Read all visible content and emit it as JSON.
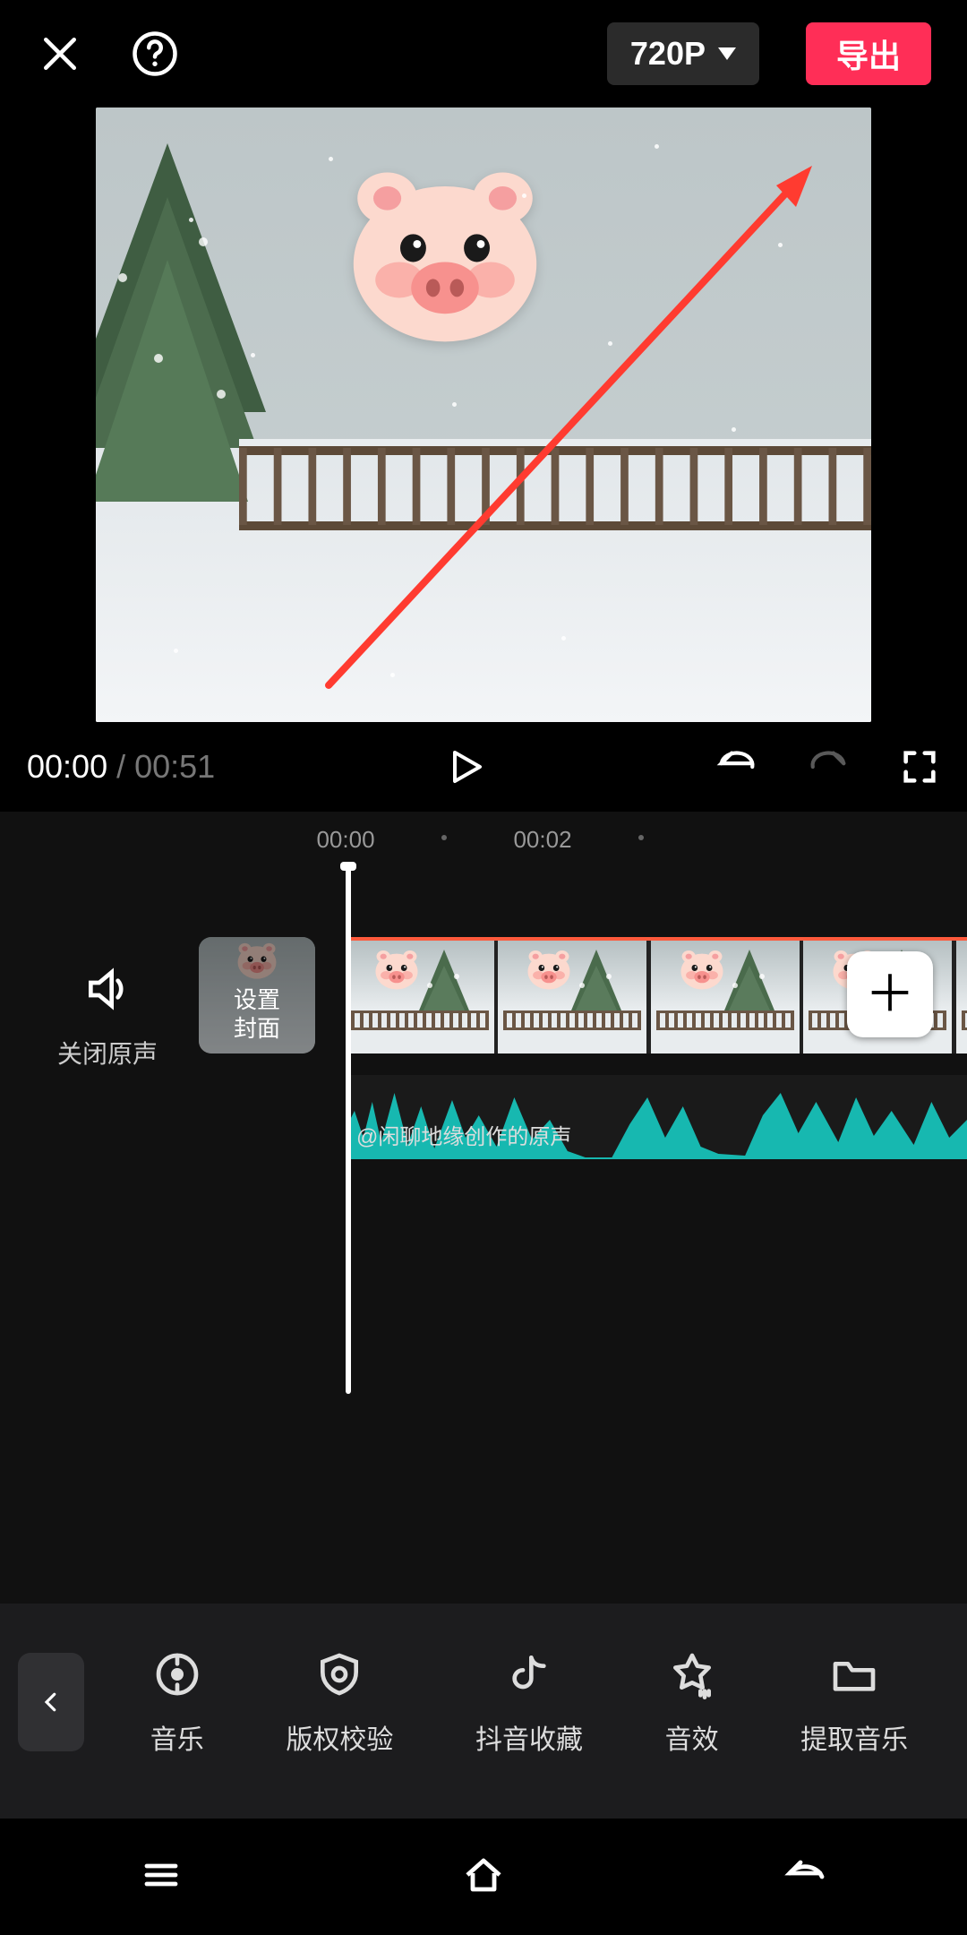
{
  "topbar": {
    "resolution_label": "720P",
    "export_label": "导出"
  },
  "transport": {
    "current_time": "00:00",
    "separator": "/",
    "duration": "00:51"
  },
  "ruler": {
    "ticks": [
      "00:00",
      "00:02"
    ]
  },
  "timeline": {
    "mute_label": "关闭原声",
    "cover_label_line1": "设置",
    "cover_label_line2": "封面",
    "audio_label": "@闲聊地缘创作的原声"
  },
  "tooltabs": {
    "items": [
      {
        "id": "music",
        "label": "音乐"
      },
      {
        "id": "copyright",
        "label": "版权校验"
      },
      {
        "id": "douyin-fav",
        "label": "抖音收藏"
      },
      {
        "id": "sound-fx",
        "label": "音效"
      },
      {
        "id": "extract",
        "label": "提取音乐"
      }
    ]
  },
  "icons": {
    "close": "close-icon",
    "help": "help-icon",
    "play": "play-icon",
    "undo": "undo-icon",
    "redo": "redo-icon",
    "fullscreen": "fullscreen-icon",
    "speaker": "speaker-icon",
    "plus": "plus-icon",
    "back": "chevron-left-icon"
  },
  "colors": {
    "accent_red": "#ff2e57",
    "clip_outline": "#ff5a3c",
    "waveform": "#17b8b0"
  }
}
